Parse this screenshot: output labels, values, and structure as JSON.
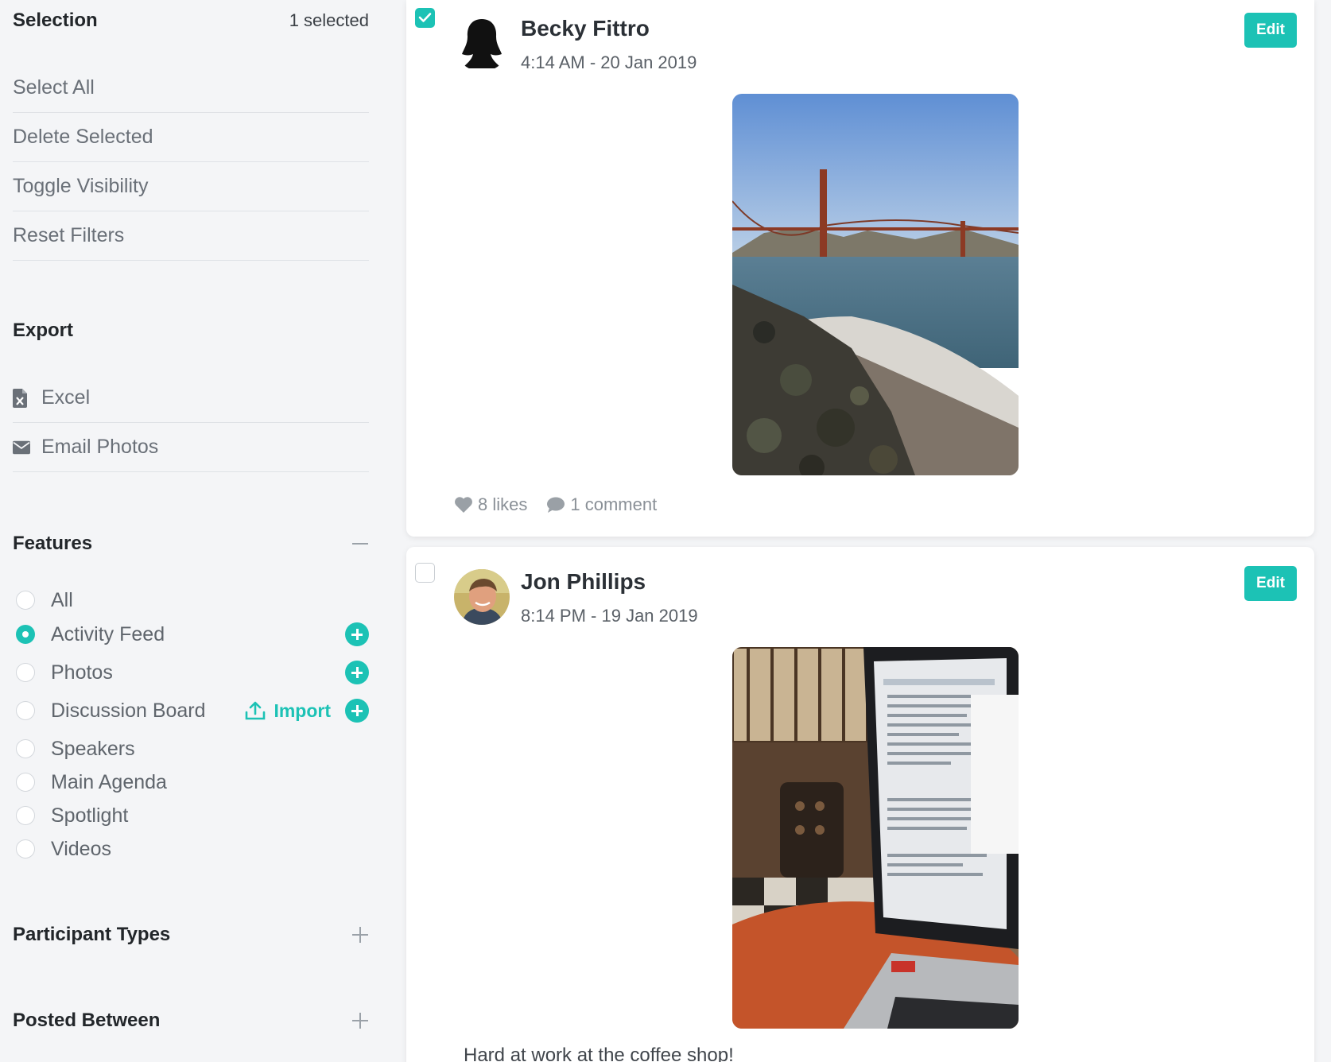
{
  "sidebar": {
    "selection": {
      "title": "Selection",
      "count": "1 selected",
      "actions": [
        "Select All",
        "Delete Selected",
        "Toggle Visibility",
        "Reset Filters"
      ]
    },
    "export": {
      "title": "Export",
      "items": [
        {
          "label": "Excel",
          "icon": "excel-file-icon"
        },
        {
          "label": "Email Photos",
          "icon": "envelope-icon"
        }
      ]
    },
    "features": {
      "title": "Features",
      "import_label": "Import",
      "options": [
        {
          "label": "All",
          "checked": false,
          "add": false
        },
        {
          "label": "Activity Feed",
          "checked": true,
          "add": true
        },
        {
          "label": "Photos",
          "checked": false,
          "add": true
        },
        {
          "label": "Discussion Board",
          "checked": false,
          "add": true,
          "import": true
        },
        {
          "label": "Speakers",
          "checked": false,
          "add": false
        },
        {
          "label": "Main Agenda",
          "checked": false,
          "add": false
        },
        {
          "label": "Spotlight",
          "checked": false,
          "add": false
        },
        {
          "label": "Videos",
          "checked": false,
          "add": false
        }
      ]
    },
    "participant_types": {
      "title": "Participant Types"
    },
    "posted_between": {
      "title": "Posted Between"
    }
  },
  "posts": [
    {
      "author": "Becky Fittro",
      "timestamp": "4:14 AM - 20 Jan 2019",
      "selected": true,
      "edit_label": "Edit",
      "likes": "8 likes",
      "comments": "1 comment"
    },
    {
      "author": "Jon Phillips",
      "timestamp": "8:14 PM - 19 Jan 2019",
      "selected": false,
      "edit_label": "Edit",
      "caption": "Hard at work at the coffee shop!"
    }
  ],
  "colors": {
    "accent": "#1cc2b5",
    "background": "#f4f5f7",
    "card": "#ffffff"
  }
}
